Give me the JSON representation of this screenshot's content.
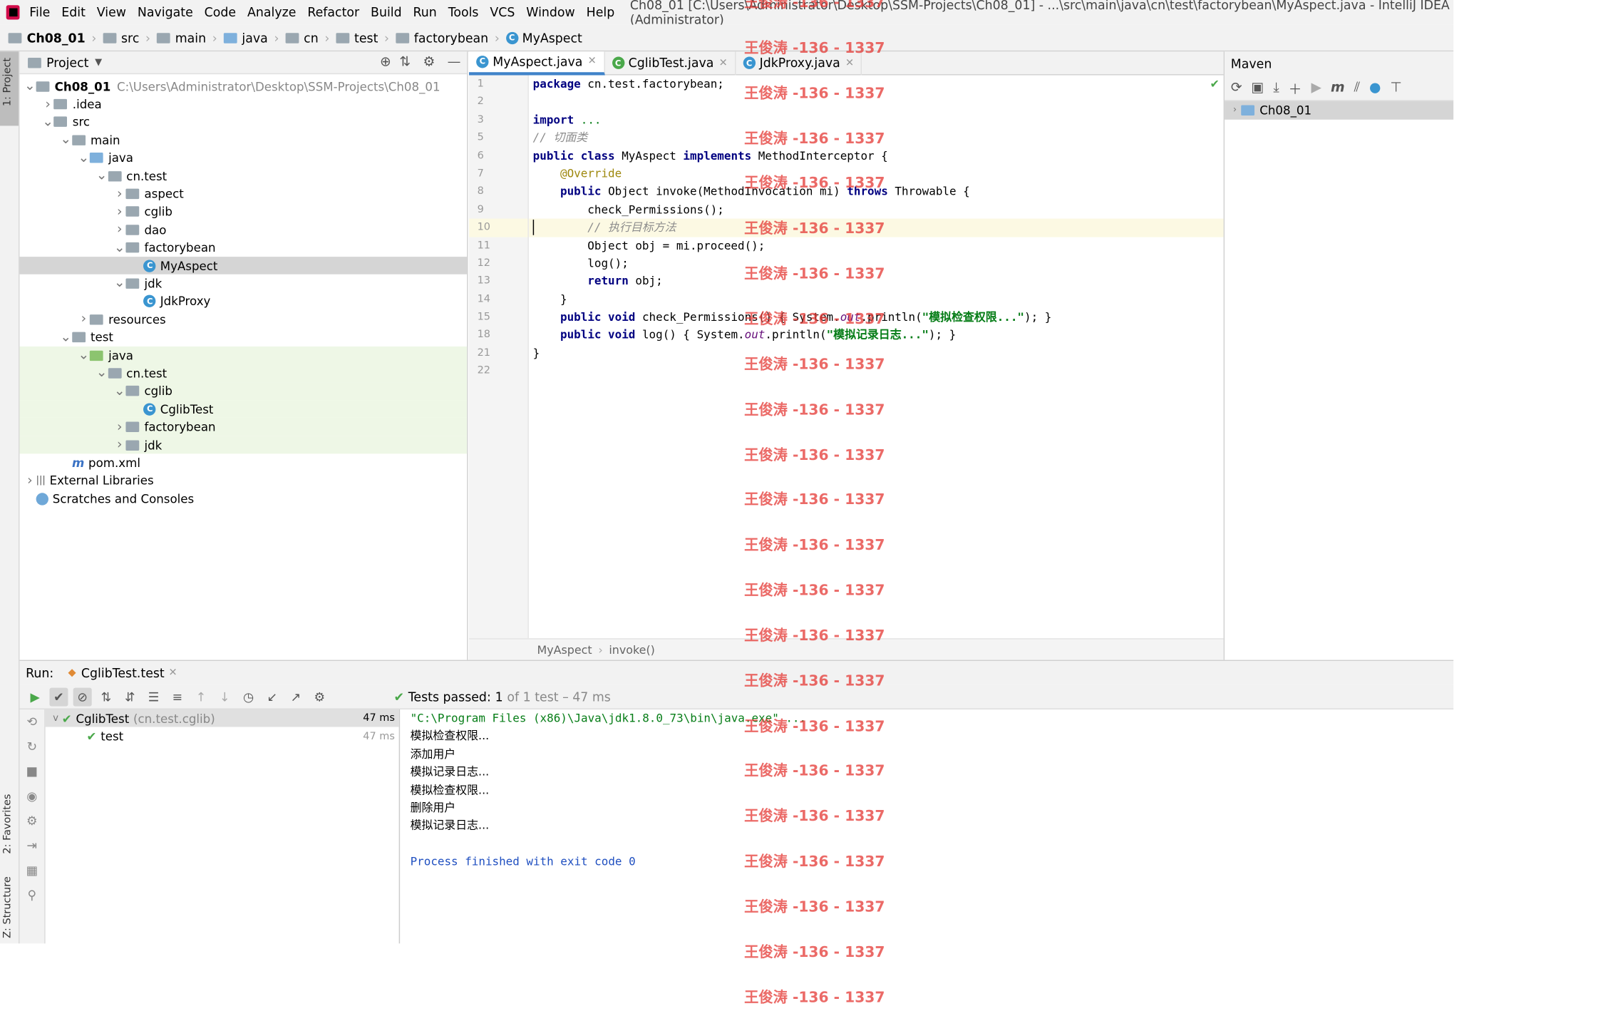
{
  "menubar": {
    "items": [
      "File",
      "Edit",
      "View",
      "Navigate",
      "Code",
      "Analyze",
      "Refactor",
      "Build",
      "Run",
      "Tools",
      "VCS",
      "Window",
      "Help"
    ],
    "title": "Ch08_01 [C:\\Users\\Administrator\\Desktop\\SSM-Projects\\Ch08_01] - ...\\src\\main\\java\\cn\\test\\factorybean\\MyAspect.java - IntelliJ IDEA (Administrator)"
  },
  "breadcrumb": [
    "Ch08_01",
    "src",
    "main",
    "java",
    "cn",
    "test",
    "factorybean",
    "MyAspect"
  ],
  "side_tabs": {
    "project": "1: Project",
    "favorites": "2: Favorites",
    "structure": "Z: Structure"
  },
  "project": {
    "header": "Project",
    "root_path": "C:\\Users\\Administrator\\Desktop\\SSM-Projects\\Ch08_01",
    "tree": [
      {
        "label": "Ch08_01",
        "indent": 0,
        "arrow": "v",
        "icon": "folder",
        "bold": true
      },
      {
        "label": ".idea",
        "indent": 1,
        "arrow": ">",
        "icon": "folder"
      },
      {
        "label": "src",
        "indent": 1,
        "arrow": "v",
        "icon": "folder"
      },
      {
        "label": "main",
        "indent": 2,
        "arrow": "v",
        "icon": "folder"
      },
      {
        "label": "java",
        "indent": 3,
        "arrow": "v",
        "icon": "folder-blue"
      },
      {
        "label": "cn.test",
        "indent": 4,
        "arrow": "v",
        "icon": "folder"
      },
      {
        "label": "aspect",
        "indent": 5,
        "arrow": ">",
        "icon": "folder"
      },
      {
        "label": "cglib",
        "indent": 5,
        "arrow": ">",
        "icon": "folder"
      },
      {
        "label": "dao",
        "indent": 5,
        "arrow": ">",
        "icon": "folder"
      },
      {
        "label": "factorybean",
        "indent": 5,
        "arrow": "v",
        "icon": "folder"
      },
      {
        "label": "MyAspect",
        "indent": 6,
        "arrow": "",
        "icon": "class",
        "sel": true
      },
      {
        "label": "jdk",
        "indent": 5,
        "arrow": "v",
        "icon": "folder"
      },
      {
        "label": "JdkProxy",
        "indent": 6,
        "arrow": "",
        "icon": "class"
      },
      {
        "label": "resources",
        "indent": 3,
        "arrow": ">",
        "icon": "folder"
      },
      {
        "label": "test",
        "indent": 2,
        "arrow": "v",
        "icon": "folder"
      },
      {
        "label": "java",
        "indent": 3,
        "arrow": "v",
        "icon": "folder-green",
        "tst": true
      },
      {
        "label": "cn.test",
        "indent": 4,
        "arrow": "v",
        "icon": "folder",
        "tst": true
      },
      {
        "label": "cglib",
        "indent": 5,
        "arrow": "v",
        "icon": "folder",
        "tst": true
      },
      {
        "label": "CglibTest",
        "indent": 6,
        "arrow": "",
        "icon": "class",
        "tst": true
      },
      {
        "label": "factorybean",
        "indent": 5,
        "arrow": ">",
        "icon": "folder",
        "tst": true
      },
      {
        "label": "jdk",
        "indent": 5,
        "arrow": ">",
        "icon": "folder",
        "tst": true
      },
      {
        "label": "pom.xml",
        "indent": 2,
        "arrow": "",
        "icon": "maven"
      },
      {
        "label": "External Libraries",
        "indent": 0,
        "arrow": ">",
        "icon": "lib"
      },
      {
        "label": "Scratches and Consoles",
        "indent": 0,
        "arrow": "",
        "icon": "scratch"
      }
    ]
  },
  "editor": {
    "tabs": [
      {
        "label": "MyAspect.java",
        "active": true
      },
      {
        "label": "CglibTest.java",
        "active": false
      },
      {
        "label": "JdkProxy.java",
        "active": false
      }
    ],
    "lines": [
      {
        "n": "1",
        "html": "<span class='kw'>package</span> cn.test.factorybean;"
      },
      {
        "n": "2",
        "html": ""
      },
      {
        "n": "3",
        "html": "<span class='kw'>import</span> <span style='color:#067d17'>...</span>"
      },
      {
        "n": "5",
        "html": "<span class='cm'>// 切面类</span>"
      },
      {
        "n": "6",
        "html": "<span class='kw'>public class</span> MyAspect <span class='kw'>implements</span> MethodInterceptor {"
      },
      {
        "n": "7",
        "html": "    <span class='an'>@Override</span>"
      },
      {
        "n": "8",
        "html": "    <span class='kw'>public</span> Object invoke(MethodInvocation mi) <span class='kw'>throws</span> Throwable {"
      },
      {
        "n": "9",
        "html": "        check_Permissions();"
      },
      {
        "n": "10",
        "html": "        <span class='cm'>// 执行目标方法</span>",
        "cur": true
      },
      {
        "n": "11",
        "html": "        Object obj = mi.proceed();"
      },
      {
        "n": "12",
        "html": "        log();"
      },
      {
        "n": "13",
        "html": "        <span class='kw'>return</span> obj;"
      },
      {
        "n": "14",
        "html": "    }"
      },
      {
        "n": "15",
        "html": "    <span class='kw'>public void</span> check_Permissions() { System.<span class='st'>out</span>.println(<span class='str'>\"模拟检查权限...\"</span>); }"
      },
      {
        "n": "18",
        "html": "    <span class='kw'>public void</span> log() { System.<span class='st'>out</span>.println(<span class='str'>\"模拟记录日志...\"</span>); }"
      },
      {
        "n": "21",
        "html": "}"
      },
      {
        "n": "22",
        "html": ""
      }
    ],
    "footer": [
      "MyAspect",
      "invoke()"
    ]
  },
  "maven": {
    "title": "Maven",
    "project": "Ch08_01"
  },
  "run": {
    "label": "Run:",
    "config": "CglibTest.test",
    "status_prefix": "Tests passed:",
    "status_count": "1",
    "status_suffix": "of 1 test – 47 ms",
    "tree": [
      {
        "label": "CglibTest",
        "hint": "(cn.test.cglib)",
        "time": "47 ms"
      },
      {
        "label": "test",
        "hint": "",
        "time": "47 ms"
      }
    ],
    "console": [
      "\"C:\\Program Files (x86)\\Java\\jdk1.8.0_73\\bin\\java.exe\" ...",
      "模拟检查权限...",
      "添加用户",
      "模拟记录日志...",
      "模拟检查权限...",
      "删除用户",
      "模拟记录日志...",
      "",
      "Process finished with exit code 0"
    ]
  },
  "watermark": "王俊涛 -136 - 1337",
  "watermark_count": 23
}
